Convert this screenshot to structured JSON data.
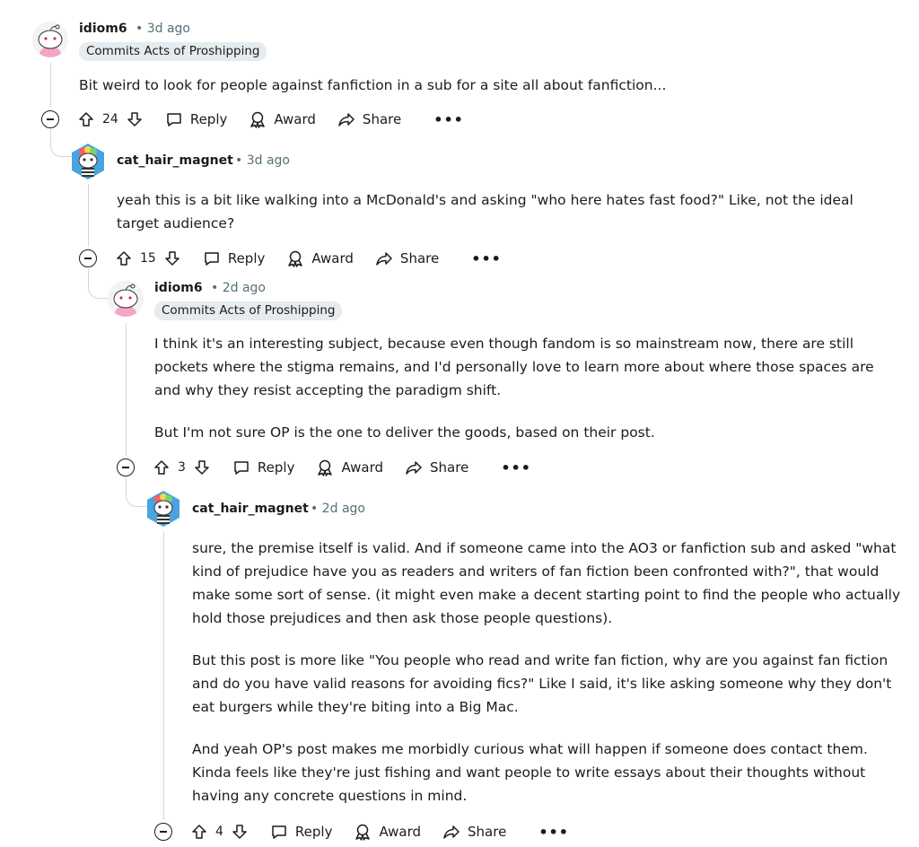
{
  "comments": [
    {
      "username": "idiom6",
      "age": "3d ago",
      "flair": "Commits Acts of Proshipping",
      "body": [
        "Bit weird to look for people against fanfiction in a sub for a site all about fanfiction..."
      ],
      "votes": "24",
      "avatar": "snoo-heart-eyes-avatar"
    },
    {
      "username": "cat_hair_magnet",
      "age": "3d ago",
      "flair": "",
      "body": [
        "yeah this is a bit like walking into a McDonald's and asking \"who here hates fast food?\" Like, not the ideal target audience?"
      ],
      "votes": "15",
      "avatar": "snoo-rainbow-hair-avatar"
    },
    {
      "username": "idiom6",
      "age": "2d ago",
      "flair": "Commits Acts of Proshipping",
      "body": [
        "I think it's an interesting subject, because even though fandom is so mainstream now, there are still pockets where the stigma remains, and I'd personally love to learn more about where those spaces are and why they resist accepting the paradigm shift.",
        "But I'm not sure OP is the one to deliver the goods, based on their post."
      ],
      "votes": "3",
      "avatar": "snoo-heart-eyes-avatar"
    },
    {
      "username": "cat_hair_magnet",
      "age": "2d ago",
      "flair": "",
      "body": [
        "sure, the premise itself is valid. And if someone came into the AO3 or fanfiction sub and asked \"what kind of prejudice have you as readers and writers of fan fiction been confronted with?\", that would make some sort of sense. (it might even make a decent starting point to find the people who actually hold those prejudices and then ask those people questions).",
        "But this post is more like \"You people who read and write fan fiction, why are you against fan fiction and do you have valid reasons for avoiding fics?\" Like I said, it's like asking someone why they don't eat burgers while they're biting into a Big Mac.",
        "And yeah OP's post makes me morbidly curious what will happen if someone does contact them. Kinda feels like they're just fishing and want people to write essays about their thoughts without having any concrete questions in mind."
      ],
      "votes": "4",
      "avatar": "snoo-rainbow-hair-avatar"
    }
  ],
  "actions": {
    "reply": "Reply",
    "award": "Award",
    "share": "Share",
    "more": "•••",
    "separator": "•"
  },
  "colors": {
    "meta": "#576f76",
    "flair_bg": "#e5ebee",
    "thread_line": "#d4d7d9"
  }
}
